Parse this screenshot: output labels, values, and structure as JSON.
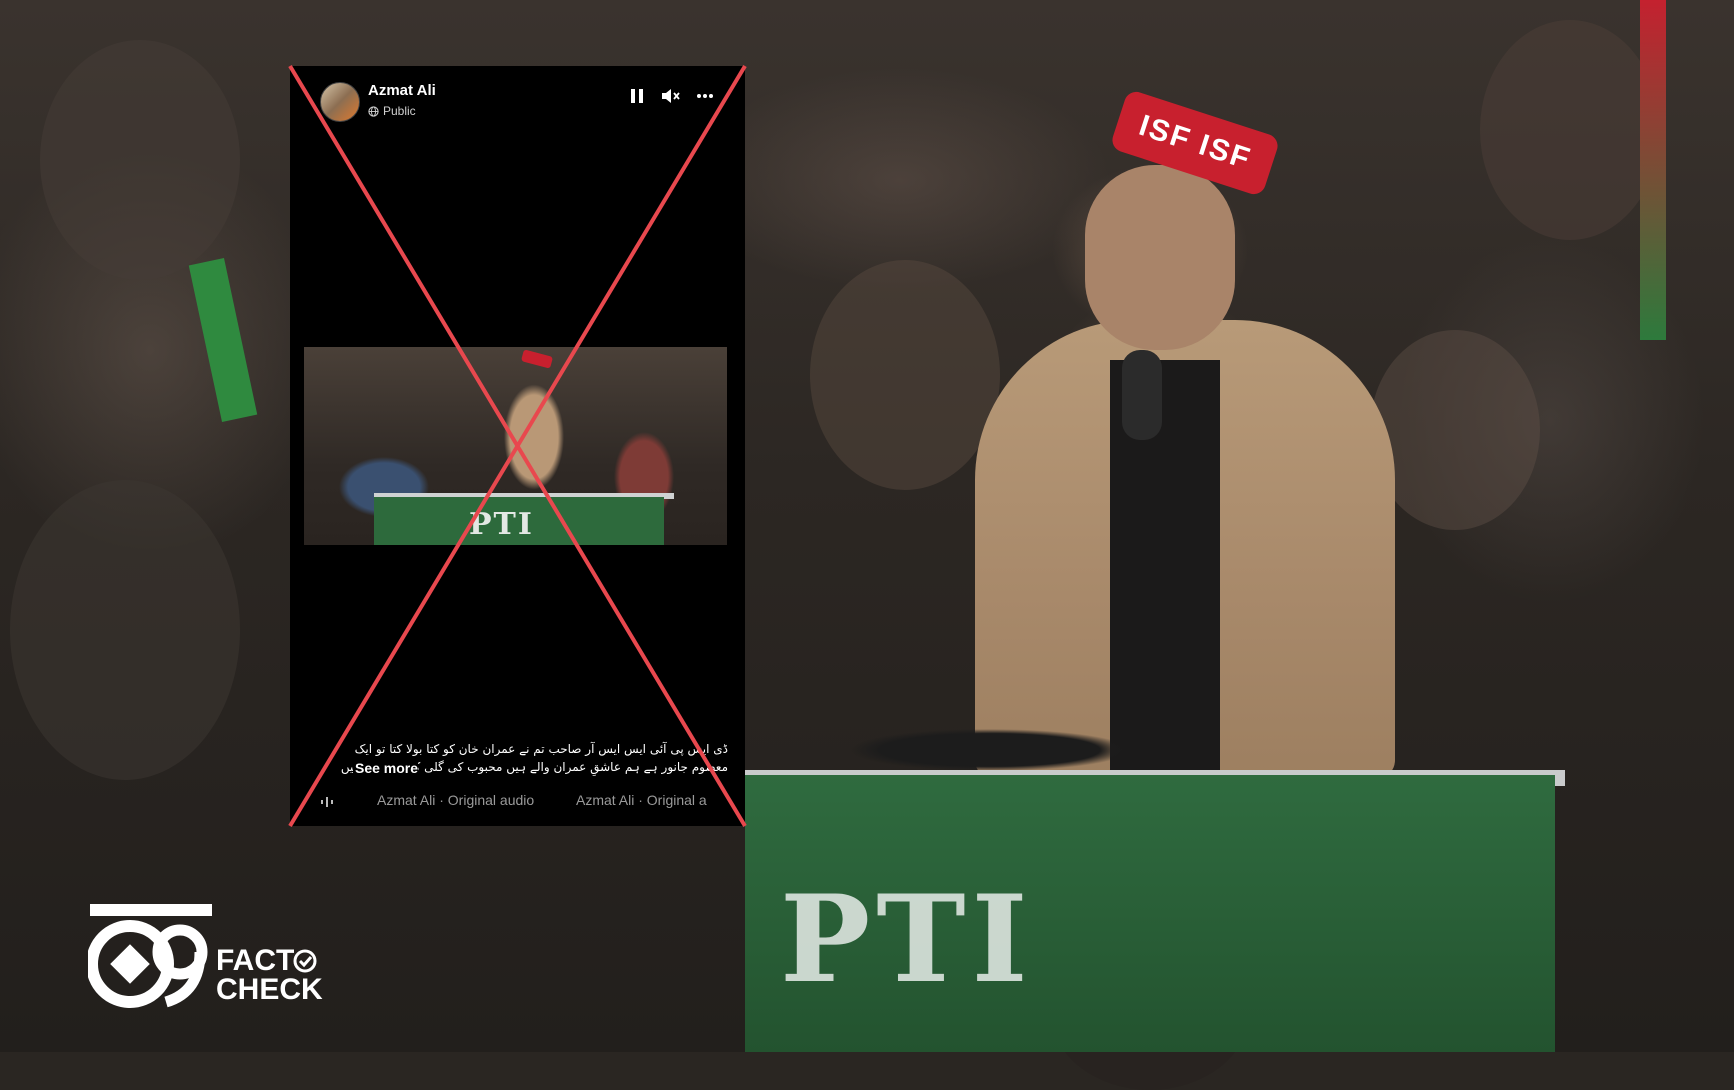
{
  "background": {
    "scene": "rally-photo",
    "podium_text": "PTI",
    "cap_text": "ISF ISF"
  },
  "post": {
    "author": "Azmat Ali",
    "privacy": "Public",
    "controls": [
      "pause-icon",
      "mute-icon",
      "more-icon"
    ],
    "video_podium_text": "PTI",
    "caption": "ڈی ایس پی آئی ایس ایس آر صاحب تم نے عمران خان کو کتا بولا کتا تو ایک معصوم جانور ہے ہم عاشقِ عمران والے ہیں محبوب کی گلی کا کتا بھی ہمیں اپنے ماں باپ سے زیادہ...",
    "see_more": "See more",
    "audio_labels": [
      "Azmat Ali · Original audio",
      "Azmat Ali · Original a"
    ]
  },
  "overlay": {
    "cross_color": "#e8484e"
  },
  "brand": {
    "line1": "FACT",
    "line2": "CHECK"
  }
}
